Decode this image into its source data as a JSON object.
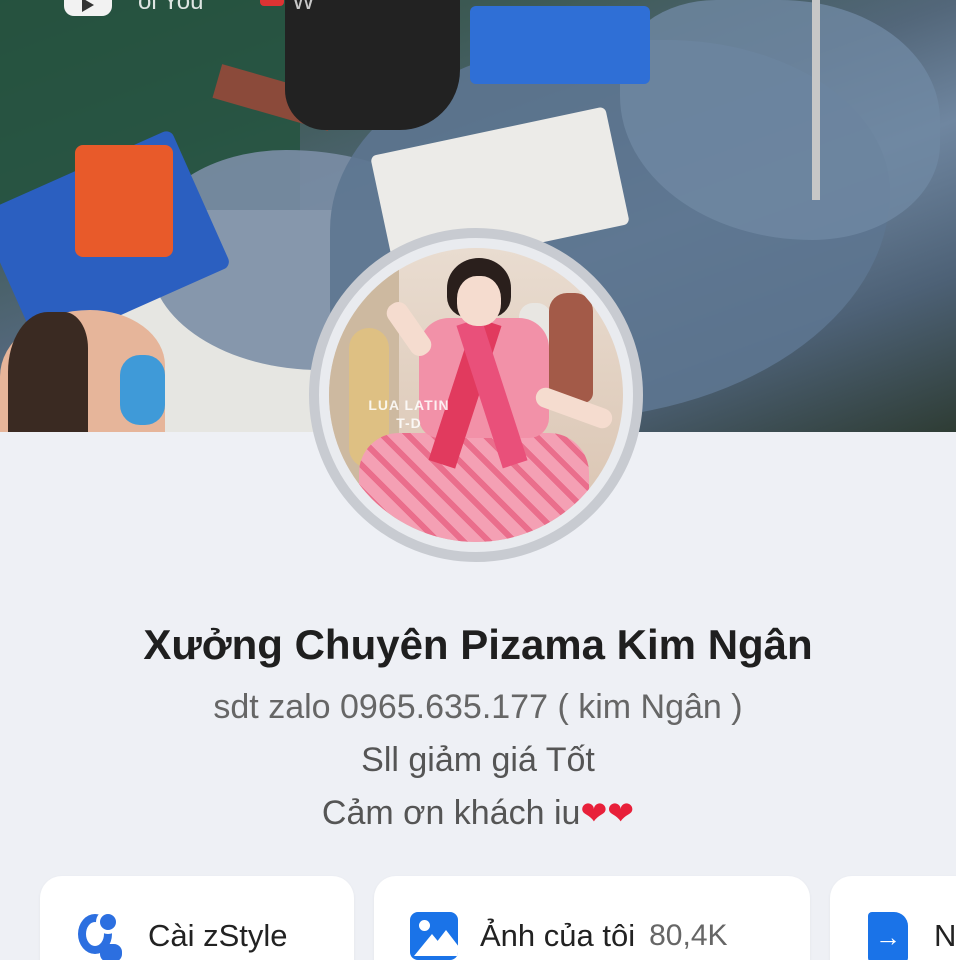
{
  "cover": {
    "top_text_left": "oi You",
    "top_text_right": "W"
  },
  "avatar": {
    "watermark_line1": "LUA LATIN",
    "watermark_line2": "T-D"
  },
  "profile": {
    "name": "Xưởng Chuyên Pizama Kim Ngân",
    "bio_line1": "sdt zalo 0965.635.177 ( kim Ngân )",
    "bio_line2": "Sll giảm giá Tốt",
    "bio_line3": "Cảm ơn khách iu",
    "bio_emoji": "❤❤"
  },
  "actions": {
    "zstyle_label": "Cài zStyle",
    "photos_label": "Ảnh của tôi",
    "photos_count": "80,4K",
    "third_label": "N"
  },
  "colors": {
    "accent": "#1a73e8",
    "heart": "#e8203a",
    "background": "#eef0f5"
  },
  "icons": [
    "play-icon",
    "zstyle-icon",
    "photo-album-icon",
    "document-arrow-icon"
  ]
}
